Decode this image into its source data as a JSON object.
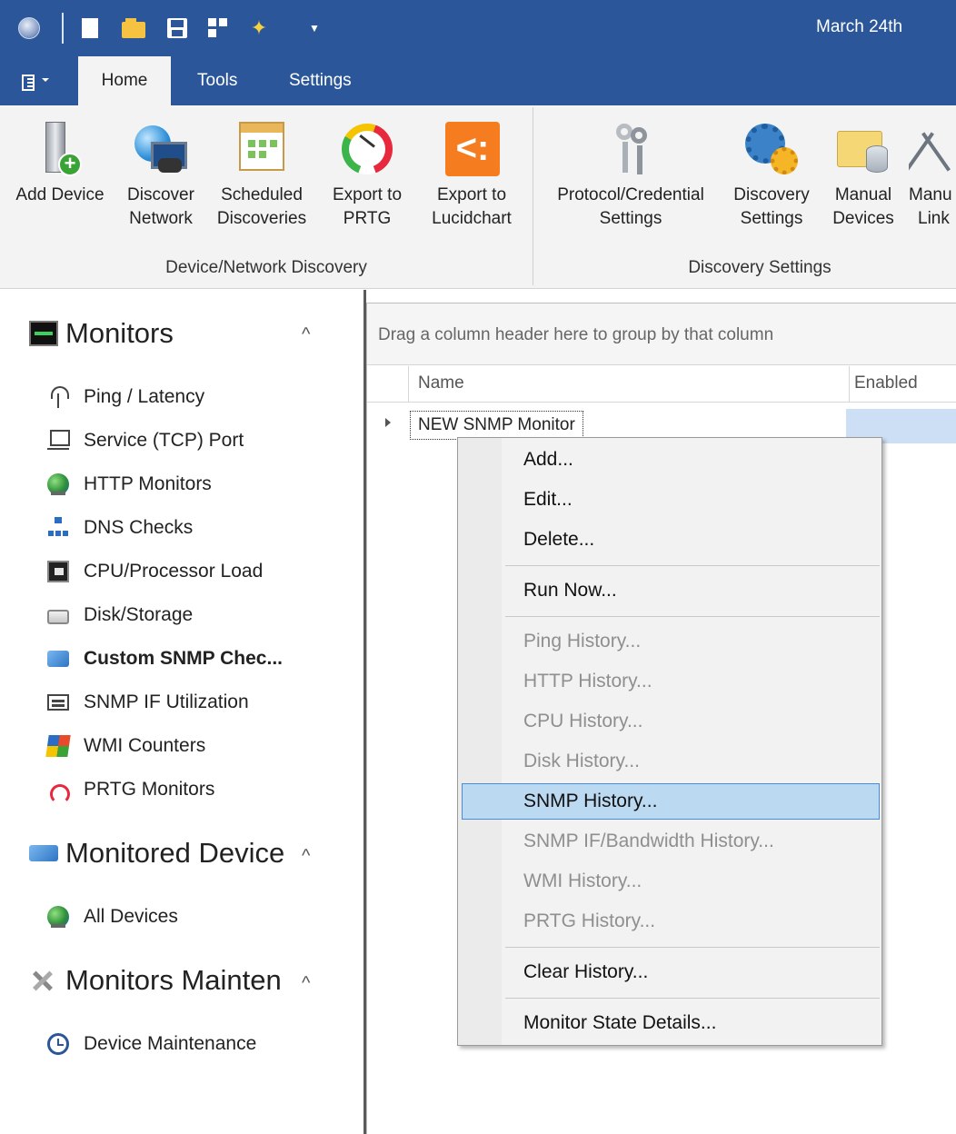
{
  "window": {
    "date": "March 24th"
  },
  "ribbon": {
    "tabs": [
      {
        "label": "Home",
        "active": true
      },
      {
        "label": "Tools",
        "active": false
      },
      {
        "label": "Settings",
        "active": false
      }
    ],
    "groups": [
      {
        "label": "Device/Network Discovery",
        "buttons": [
          {
            "label_line1": "Add Device",
            "label_line2": "",
            "icon": "add-device-icon"
          },
          {
            "label_line1": "Discover",
            "label_line2": "Network",
            "icon": "discover-network-icon"
          },
          {
            "label_line1": "Scheduled",
            "label_line2": "Discoveries",
            "icon": "calendar-icon"
          },
          {
            "label_line1": "Export to",
            "label_line2": "PRTG",
            "icon": "prtg-gauge-icon"
          },
          {
            "label_line1": "Export to",
            "label_line2": "Lucidchart",
            "icon": "lucidchart-icon"
          }
        ]
      },
      {
        "label": "Discovery Settings",
        "buttons": [
          {
            "label_line1": "Protocol/Credential",
            "label_line2": "Settings",
            "icon": "keys-icon"
          },
          {
            "label_line1": "Discovery",
            "label_line2": "Settings",
            "icon": "gears-icon"
          },
          {
            "label_line1": "Manual",
            "label_line2": "Devices",
            "icon": "folder-database-icon"
          },
          {
            "label_line1": "Manu",
            "label_line2": "Link",
            "icon": "links-icon"
          }
        ]
      }
    ]
  },
  "sidebar": {
    "sections": [
      {
        "title": "Monitors",
        "items": [
          {
            "label": "Ping / Latency",
            "icon": "ping-icon"
          },
          {
            "label": "Service (TCP) Port",
            "icon": "tcp-port-icon"
          },
          {
            "label": "HTTP Monitors",
            "icon": "globe-icon"
          },
          {
            "label": "DNS Checks",
            "icon": "dns-icon"
          },
          {
            "label": "CPU/Processor Load",
            "icon": "cpu-icon"
          },
          {
            "label": "Disk/Storage",
            "icon": "disk-icon"
          },
          {
            "label": "Custom SNMP Chec...",
            "icon": "snmp-icon",
            "selected": true
          },
          {
            "label": "SNMP IF Utilization",
            "icon": "snmp-if-icon"
          },
          {
            "label": "WMI Counters",
            "icon": "wmi-icon"
          },
          {
            "label": "PRTG Monitors",
            "icon": "prtg-icon"
          }
        ]
      },
      {
        "title": "Monitored Device",
        "items": [
          {
            "label": "All Devices",
            "icon": "globe-icon"
          }
        ]
      },
      {
        "title": "Monitors Mainten",
        "items": [
          {
            "label": "Device Maintenance",
            "icon": "clock-icon"
          }
        ]
      }
    ]
  },
  "grid": {
    "group_hint": "Drag a column header here to group by that column",
    "columns": [
      "Name",
      "Enabled"
    ],
    "rows": [
      {
        "name": "NEW SNMP Monitor"
      }
    ]
  },
  "context_menu": {
    "items": [
      {
        "label": "Add...",
        "enabled": true
      },
      {
        "label": "Edit...",
        "enabled": true
      },
      {
        "label": "Delete...",
        "enabled": true
      },
      {
        "label": "Run Now...",
        "enabled": true
      },
      {
        "label": "Ping History...",
        "enabled": false
      },
      {
        "label": "HTTP History...",
        "enabled": false
      },
      {
        "label": "CPU History...",
        "enabled": false
      },
      {
        "label": "Disk History...",
        "enabled": false
      },
      {
        "label": "SNMP History...",
        "enabled": true,
        "highlighted": true
      },
      {
        "label": "SNMP IF/Bandwidth History...",
        "enabled": false
      },
      {
        "label": "WMI History...",
        "enabled": false
      },
      {
        "label": "PRTG History...",
        "enabled": false
      },
      {
        "label": "Clear History...",
        "enabled": true
      },
      {
        "label": "Monitor State Details...",
        "enabled": true
      }
    ]
  },
  "colors": {
    "title_bar": "#2b579a",
    "ribbon_bg": "#f3f3f3",
    "menu_highlight": "#bcd9f2",
    "row_selected": "#cddff4"
  }
}
